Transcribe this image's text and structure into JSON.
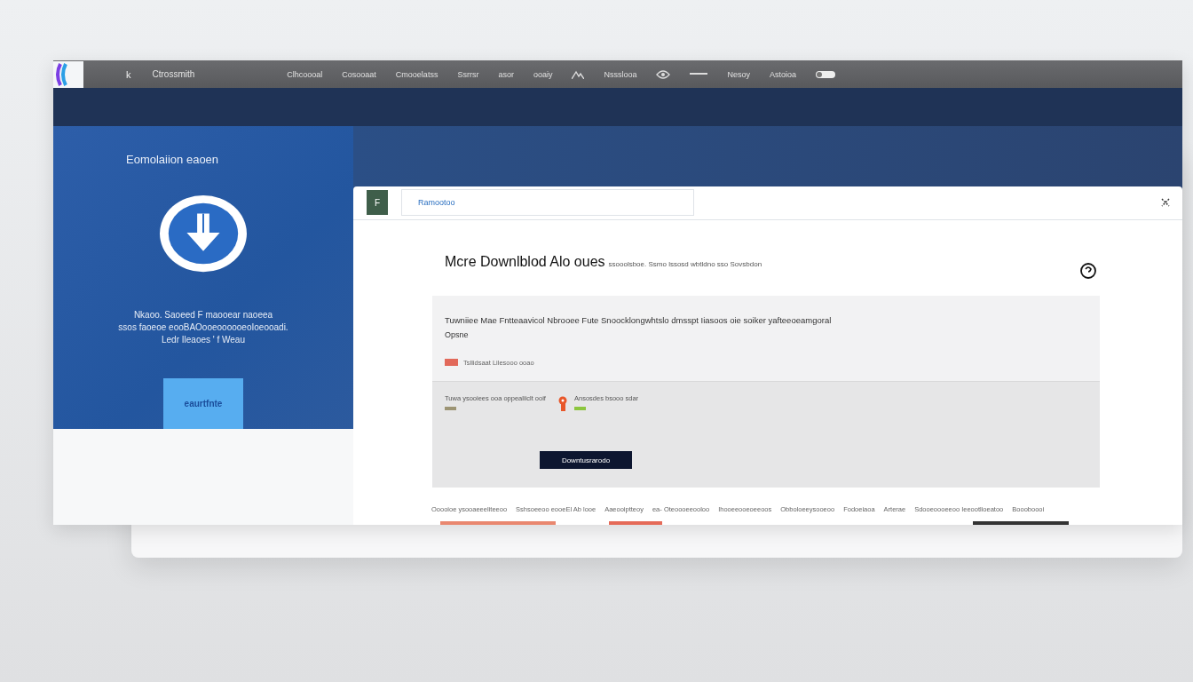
{
  "top_bar": {
    "logo_letter": "k",
    "brand": "Ctrossmith",
    "menu": [
      {
        "kind": "text",
        "label": "Clhcoooal"
      },
      {
        "kind": "text",
        "label": "Cosooaat"
      },
      {
        "kind": "text",
        "label": "Cmooelatss"
      },
      {
        "kind": "text",
        "label": "Ssrrsr"
      },
      {
        "kind": "text",
        "label": "asor"
      },
      {
        "kind": "text",
        "label": "ooaiy"
      },
      {
        "kind": "mountain"
      },
      {
        "kind": "text",
        "label": "Nssslooa"
      },
      {
        "kind": "eye"
      },
      {
        "kind": "dash"
      },
      {
        "kind": "text",
        "label": "Nesoy"
      },
      {
        "kind": "text",
        "label": "Astoioa"
      },
      {
        "kind": "pill"
      }
    ]
  },
  "side_panel": {
    "title": "Eomolaiion eaoen",
    "lines": [
      "Nkaoo. Saoeed F maooear naoeea",
      "ssos faoeoe eooBAOooeoooooeoIoeooadi.",
      "Ledr  Ileaoes ' f   Weau"
    ],
    "button": "eaurtfnte"
  },
  "card": {
    "badge": "F",
    "tab_field": "Ramootoo",
    "heading": "Mcre Downlblod Alo oues",
    "subtitle": "ssooolsboe. Ssmo lssosd wbtldno sso Sovsbdon",
    "notice": {
      "text": "Tuwniiee Mae Fntteaavicol Nbrooee Fute Snoocklongwhtslo dmsspt Iiasoos oie soiker yafteeoeamgoral",
      "link": "Opsne",
      "tag": {
        "label": "Tsllidsaat Lilesooo ooao",
        "color": "#e2695a"
      }
    },
    "options": [
      {
        "label": "Tuwa ysooiees ooa oppealiiclt ooif",
        "color": "#9c9474"
      },
      {
        "label": "Ansosdes bsooo sdar",
        "color": "#8cc63f"
      }
    ],
    "download_button": "Downtusrarodo",
    "columns": [
      "Ooooioe ysooaeeeliteeoo",
      "Sshsoeeoo eooeEl Ab looe",
      "Aaeooiptteoy",
      "ea-  Oteoooeeooloo",
      "Ihooeeooeoeeoos",
      "Obboloeeysooeoo",
      "Fodoeiaoa",
      "Arterae",
      "Sdooeoooeeoo Ieeootlioeatoo",
      "Boooboooi"
    ]
  }
}
